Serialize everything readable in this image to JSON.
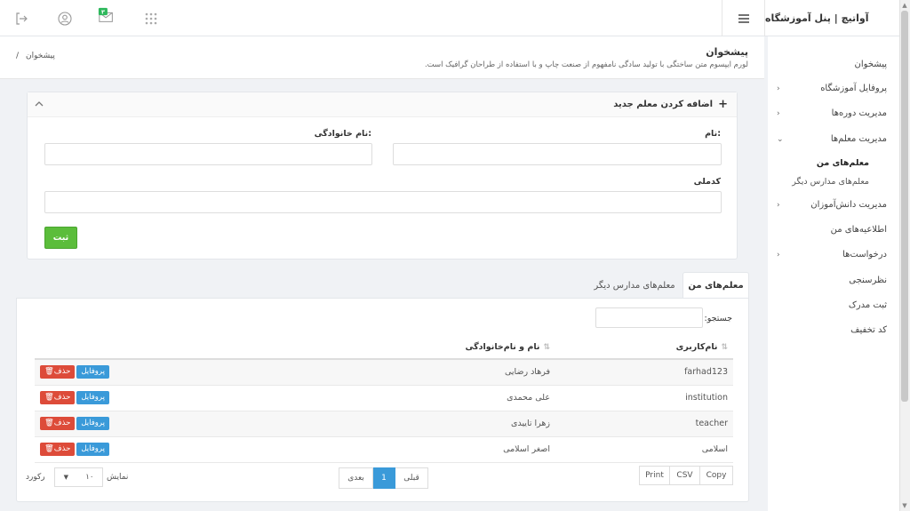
{
  "brand": {
    "title": "آواتیچ | پنل آموزشگاه"
  },
  "sidebar": {
    "items": [
      {
        "label": "پیشخوان"
      },
      {
        "label": "پروفایل آموزشگاه"
      },
      {
        "label": "مدیریت دوره‌ها"
      },
      {
        "label": "مدیریت معلم‌ها"
      },
      {
        "label": "مدیریت دانش‌آموزان"
      },
      {
        "label": "اطلاعیه‌های من"
      },
      {
        "label": "درخواست‌ها"
      },
      {
        "label": "نظرسنجی"
      },
      {
        "label": "ثبت مدرک"
      },
      {
        "label": "کد تخفیف"
      }
    ],
    "subitems": [
      {
        "label": "معلم‌های من"
      },
      {
        "label": "معلم‌های مدارس دیگر"
      }
    ]
  },
  "header": {
    "title": "پیشخوان",
    "subtitle": "لورم ایپسوم متن ساختگی با تولید سادگی نامفهوم از صنعت چاپ و با استفاده از طراحان گرافیک است.",
    "breadcrumb": "پیشخوان",
    "breadcrumb_sep": "/"
  },
  "form": {
    "title": "اضافه کردن معلم جدید",
    "plus": "+",
    "first_name_label": "نام:",
    "last_name_label": "نام خانوادگی:",
    "national_code_label": "کدملی",
    "first_name_value": "",
    "last_name_value": "",
    "national_code_value": "",
    "submit_label": "ثبت"
  },
  "tabs": [
    {
      "label": "معلم‌های من"
    },
    {
      "label": "معلم‌های مدارس دیگر"
    }
  ],
  "table": {
    "search_label": "جستجو:",
    "search_value": "",
    "columns": [
      "نام‌کاربری",
      "نام و نام‌خانوادگی"
    ],
    "rows": [
      {
        "username": "farhad123",
        "fullname": "فرهاد رضایی"
      },
      {
        "username": "institution",
        "fullname": "علی محمدی"
      },
      {
        "username": "teacher",
        "fullname": "زهرا تاییدی"
      },
      {
        "username": "اسلامی",
        "fullname": "اصغر اسلامی"
      }
    ],
    "profile_label": "پروفایل",
    "delete_label": "حذف",
    "prev_label": "قبلی",
    "next_label": "بعدی",
    "current_page": "1",
    "export": [
      "Copy",
      "CSV",
      "Print"
    ],
    "show_label": "نمایش",
    "records_label": "رکورد",
    "page_length": "۱۰"
  },
  "colors": {
    "accent": "#3a9ad9",
    "success": "#5bbd3b",
    "danger": "#dd4b39",
    "badge": "#2eb85c"
  }
}
